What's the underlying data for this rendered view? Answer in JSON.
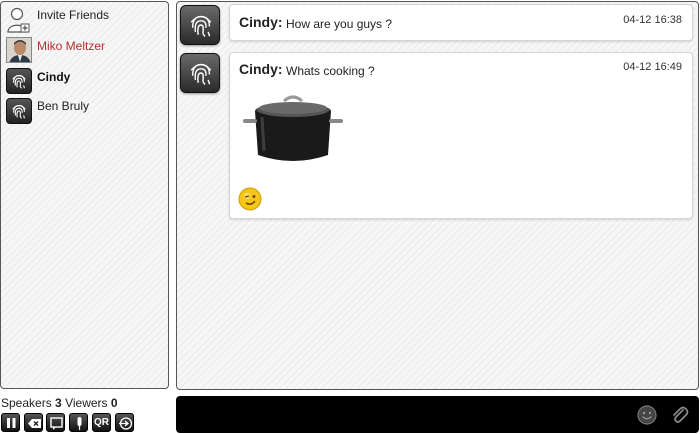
{
  "sidebar": {
    "invite_label": "Invite Friends",
    "users": [
      {
        "name": "Miko Meltzer",
        "color": "#b03030",
        "bold": false,
        "avatar": "photo-avatar"
      },
      {
        "name": "Cindy",
        "color": "#111111",
        "bold": true,
        "avatar": "fingerprint-icon"
      },
      {
        "name": "Ben Bruly",
        "color": "#222222",
        "bold": false,
        "avatar": "fingerprint-icon"
      }
    ]
  },
  "chat": {
    "messages": [
      {
        "sender": "Cindy:",
        "text": "How are you guys ?",
        "time": "04-12 16:38"
      },
      {
        "sender": "Cindy:",
        "text": "Whats cooking ?",
        "time": "04-12 16:49",
        "attachment": "cooking-pot-image",
        "emoji": "wink-smiley"
      }
    ]
  },
  "status": {
    "speakers_label": "Speakers",
    "speakers_count": "3",
    "viewers_label": "Viewers",
    "viewers_count": "0"
  },
  "toolbar": {
    "buttons": [
      "pause-icon",
      "backspace-icon",
      "chat-bubble-icon",
      "microphone-icon",
      "qr-icon",
      "logout-icon"
    ],
    "qr_label": "QR"
  },
  "composer": {
    "placeholder": "",
    "icons": [
      "smiley-icon",
      "paperclip-icon"
    ]
  }
}
